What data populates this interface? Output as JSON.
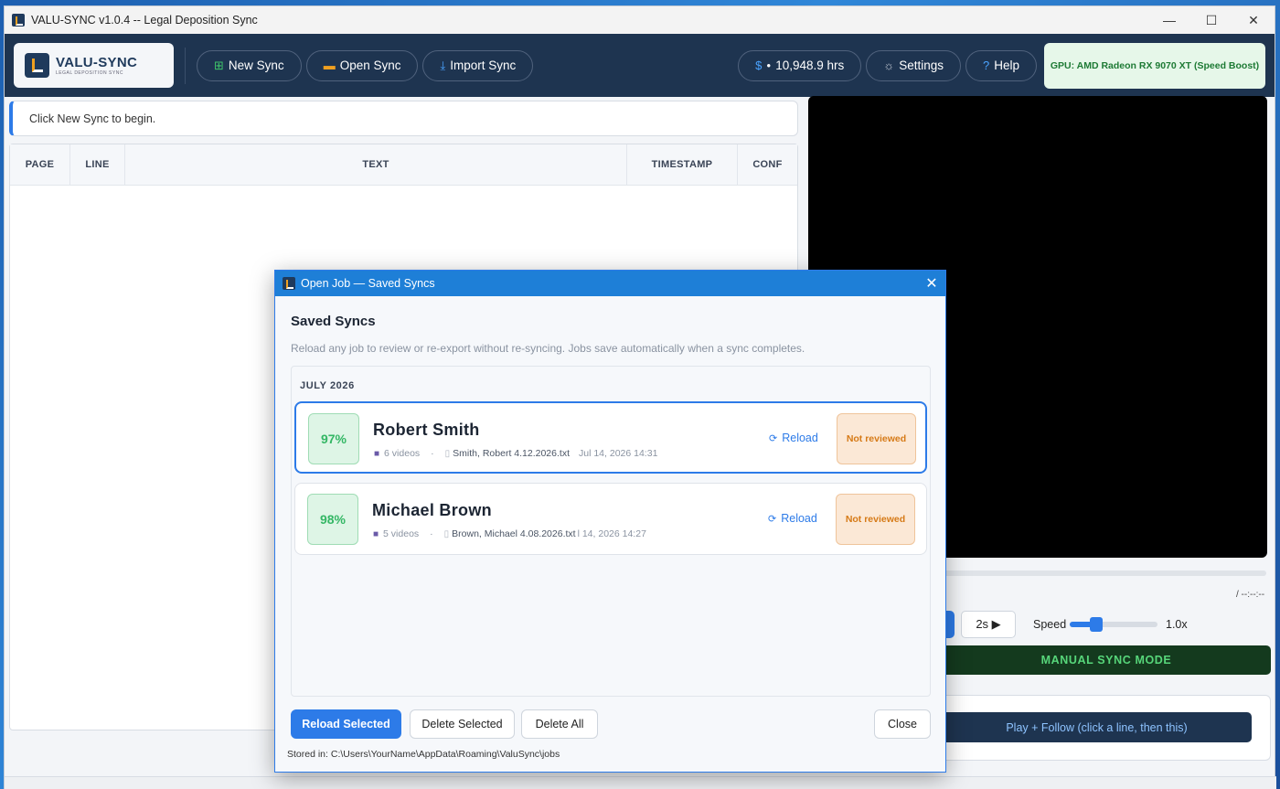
{
  "window": {
    "title": "VALU-SYNC  v1.0.4  --  Legal Deposition Sync",
    "minimize": "—",
    "maximize": "☐",
    "close": "✕"
  },
  "header": {
    "logo_name": "VALU-SYNC",
    "logo_sub": "LEGAL DEPOSITION SYNC",
    "buttons": {
      "new_sync": "New Sync",
      "open_sync": "Open Sync",
      "import_sync": "Import Sync",
      "hours": "10,948.9 hrs",
      "settings": "Settings",
      "help": "Help"
    },
    "gpu": "GPU: AMD Radeon RX 9070 XT (Speed Boost)"
  },
  "infobar": "Click  New Sync  to begin.",
  "table": {
    "columns": [
      "PAGE",
      "LINE",
      "TEXT",
      "TIMESTAMP",
      "CONF"
    ]
  },
  "player": {
    "timecode": "/ --:--:--",
    "skip": "2s ▶",
    "speed_label": "Speed",
    "speed_value": "1.0x",
    "speed_fraction": 0.3,
    "manual_mode": "MANUAL SYNC MODE",
    "follow": "Play + Follow (click a line, then this)"
  },
  "modal": {
    "title": "Open Job — Saved Syncs",
    "heading": "Saved Syncs",
    "description": "Reload any job to review or re-export without re-syncing. Jobs save automatically when a sync completes.",
    "group": "JULY 2026",
    "jobs": [
      {
        "confidence": "97%",
        "name": "Robert Smith",
        "videos": "6 videos",
        "file": "Smith, Robert 4.12.2026.txt",
        "date": "Jul 14, 2026  14:31",
        "reload": "Reload",
        "status": "Not reviewed"
      },
      {
        "confidence": "98%",
        "name": "Michael Brown",
        "videos": "5 videos",
        "file": "Brown, Michael 4.08.2026.txt",
        "date": "l 14, 2026  14:27",
        "reload": "Reload",
        "status": "Not reviewed"
      }
    ],
    "buttons": {
      "reload_selected": "Reload Selected",
      "delete_selected": "Delete Selected",
      "delete_all": "Delete All",
      "close": "Close"
    },
    "stored": "Stored in: C:\\Users\\YourName\\AppData\\Roaming\\ValuSync\\jobs"
  },
  "colors": {
    "header_bg": "#1e3450",
    "accent": "#2d7be8",
    "success": "#34b765",
    "warning": "#d67a17"
  }
}
